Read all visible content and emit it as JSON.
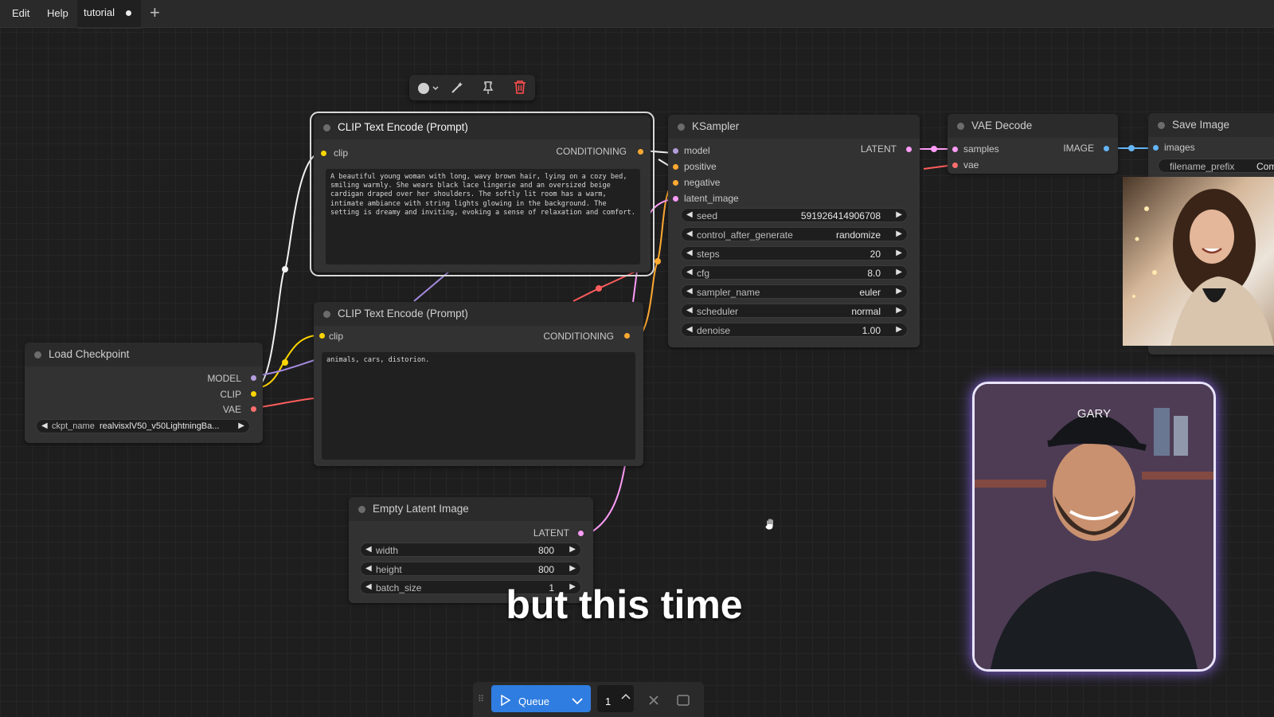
{
  "menubar": {
    "edit": "Edit",
    "help": "Help"
  },
  "tabs": [
    {
      "label": "tutorial",
      "unsaved": true
    }
  ],
  "icons": {
    "color": "color-circle-icon",
    "bypass": "wand-icon",
    "pin": "pin-icon",
    "delete": "trash-icon",
    "add_tab": "plus-icon",
    "hand": "hand-cursor-icon"
  },
  "colors": {
    "clip_pin": "#ffd500",
    "model_pin": "#b39ddb",
    "vae_pin": "#ff6e6e",
    "conditioning_pin": "#ffa931",
    "latent_pin": "#ff9cf9",
    "image_pin": "#64b5f6",
    "queue_accent": "#2f7de0"
  },
  "nodes": {
    "clip_pos": {
      "title": "CLIP Text Encode (Prompt)",
      "in_clip": "clip",
      "out": "CONDITIONING",
      "text": "A beautiful young woman with long, wavy brown hair, lying on a cozy bed, smiling warmly. She wears black lace lingerie and an oversized beige cardigan draped over her shoulders. The softly lit room has a warm, intimate ambiance with string lights glowing in the background. The setting is dreamy and inviting, evoking a sense of relaxation and comfort."
    },
    "clip_neg": {
      "title": "CLIP Text Encode (Prompt)",
      "in_clip": "clip",
      "out": "CONDITIONING",
      "text": "animals, cars, distorion."
    },
    "ksampler": {
      "title": "KSampler",
      "inputs": [
        "model",
        "positive",
        "negative",
        "latent_image"
      ],
      "out": "LATENT",
      "widgets": [
        {
          "name": "seed",
          "value": "591926414906708"
        },
        {
          "name": "control_after_generate",
          "value": "randomize"
        },
        {
          "name": "steps",
          "value": "20"
        },
        {
          "name": "cfg",
          "value": "8.0"
        },
        {
          "name": "sampler_name",
          "value": "euler"
        },
        {
          "name": "scheduler",
          "value": "normal"
        },
        {
          "name": "denoise",
          "value": "1.00"
        }
      ]
    },
    "vae_decode": {
      "title": "VAE Decode",
      "in_samples": "samples",
      "in_vae": "vae",
      "out": "IMAGE"
    },
    "save_image": {
      "title": "Save Image",
      "in_images": "images",
      "widget_name": "filename_prefix",
      "widget_value": "Com"
    },
    "load_checkpoint": {
      "title": "Load Checkpoint",
      "outputs": [
        "MODEL",
        "CLIP",
        "VAE"
      ],
      "widget_name": "ckpt_name",
      "widget_value": "realvisxlV50_v50LightningBa..."
    },
    "empty_latent": {
      "title": "Empty Latent Image",
      "out": "LATENT",
      "widgets": [
        {
          "name": "width",
          "value": "800"
        },
        {
          "name": "height",
          "value": "800"
        },
        {
          "name": "batch_size",
          "value": "1"
        }
      ]
    }
  },
  "webcam": {
    "cap_text": "GARY"
  },
  "caption": "but this time",
  "queue": {
    "label": "Queue",
    "count": "1"
  }
}
